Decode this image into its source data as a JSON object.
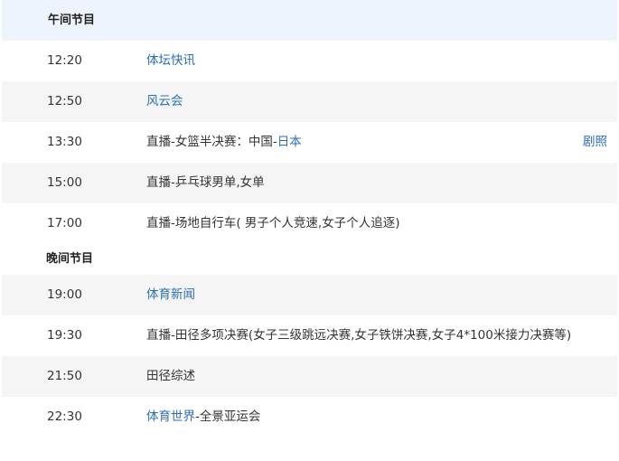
{
  "sections": [
    {
      "header": "午间节目",
      "rows": [
        {
          "time": "12:20",
          "parts": [
            {
              "text": "体坛快讯",
              "link": true
            }
          ]
        },
        {
          "time": "12:50",
          "parts": [
            {
              "text": "风云会",
              "link": true
            }
          ]
        },
        {
          "time": "13:30",
          "parts": [
            {
              "text": "直播-女篮半决赛：中国-",
              "link": false
            },
            {
              "text": "日本",
              "link": true
            }
          ],
          "action": "剧照"
        },
        {
          "time": "15:00",
          "parts": [
            {
              "text": "直播-乒乓球男单,女单",
              "link": false
            }
          ]
        },
        {
          "time": "17:00",
          "parts": [
            {
              "text": "直播-场地自行车( 男子个人竞速,女子个人追逐)",
              "link": false
            }
          ]
        }
      ]
    },
    {
      "header": "晚间节目",
      "rows": [
        {
          "time": "19:00",
          "parts": [
            {
              "text": "体育新闻",
              "link": true
            }
          ]
        },
        {
          "time": "19:30",
          "parts": [
            {
              "text": "直播-田径多项决赛(女子三级跳远决赛,女子铁饼决赛,女子4*100米接力决赛等)",
              "link": false
            }
          ]
        },
        {
          "time": "21:50",
          "parts": [
            {
              "text": "田径综述",
              "link": false
            }
          ]
        },
        {
          "time": "22:30",
          "parts": [
            {
              "text": "体育世界",
              "link": true
            },
            {
              "text": "-全景亚运会",
              "link": false
            }
          ]
        }
      ]
    }
  ],
  "colors": {
    "link": "#2a6eb5",
    "header_bg": "#eef4fb",
    "alt_row_bg": "#f5f5f5"
  }
}
